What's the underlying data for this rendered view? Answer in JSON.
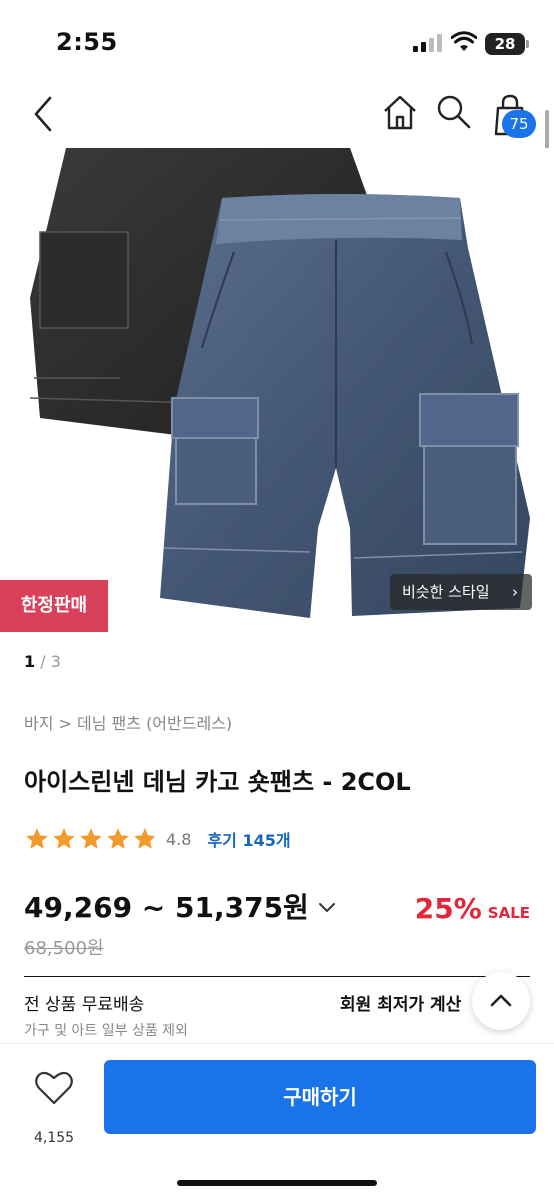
{
  "status_bar": {
    "time": "2:55",
    "battery": "28"
  },
  "header": {
    "cart_count": "75"
  },
  "hero": {
    "limited_badge": "한정판매",
    "similar_style": "비슷한 스타일",
    "page_current": "1",
    "page_separator": "/",
    "page_total": "3"
  },
  "product": {
    "breadcrumb": "바지 > 데님 팬츠 (어반드레스)",
    "title": "아이스린넨 데님 카고 숏팬츠 - 2COL",
    "rating": "4.8",
    "rating_stars": 4.8,
    "reviews": "후기 145개",
    "price_range": "49,269 ~ 51,375원",
    "discount_percent": "25%",
    "discount_label": "SALE",
    "original_price": "68,500원"
  },
  "shipping": {
    "free_shipping": "전 상품 무료배송",
    "member_price": "회원 최저가 계산",
    "note": "가구 및 아트 일부 상품 제외"
  },
  "bottom_bar": {
    "like_count": "4,155",
    "buy_label": "구매하기"
  },
  "colors": {
    "accent_blue": "#1a73e8",
    "sale_red": "#e2263b",
    "badge_red": "#d9405a",
    "star_orange": "#f29a2e"
  }
}
